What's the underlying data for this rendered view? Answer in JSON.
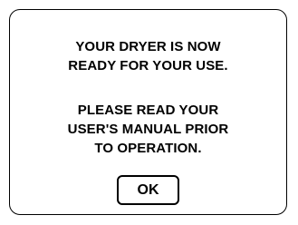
{
  "dialog": {
    "message_1": {
      "line_1": "YOUR DRYER IS NOW",
      "line_2": "READY FOR YOUR USE."
    },
    "message_2": {
      "line_1": "PLEASE READ YOUR",
      "line_2": "USER'S MANUAL PRIOR",
      "line_3": "TO OPERATION."
    },
    "ok_label": "OK"
  },
  "colors": {
    "background": "#ffffff",
    "border": "#000000",
    "text": "#000000"
  }
}
